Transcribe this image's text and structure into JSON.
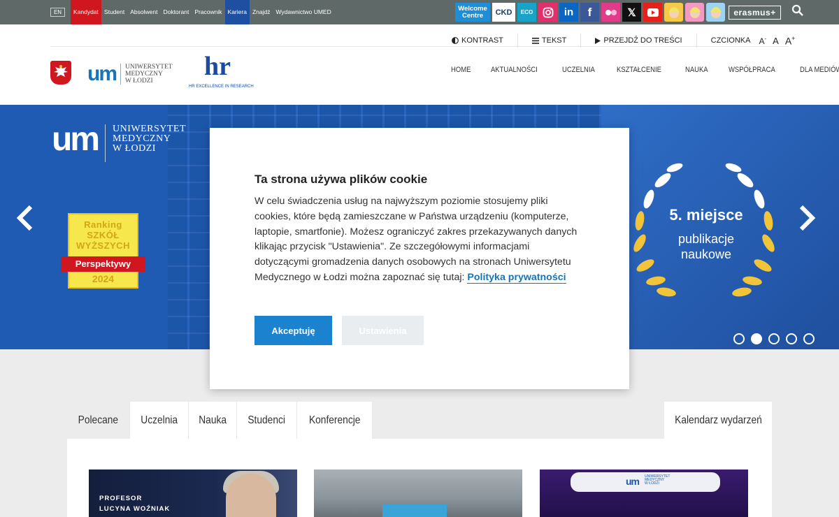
{
  "topbar": {
    "lang": "EN",
    "links": [
      {
        "label": "Kandydat",
        "style": "red"
      },
      {
        "label": "Student",
        "style": ""
      },
      {
        "label": "Absolwent",
        "style": ""
      },
      {
        "label": "Doktorant",
        "style": ""
      },
      {
        "label": "Pracownik",
        "style": ""
      },
      {
        "label": "Kariera",
        "style": "blue"
      },
      {
        "label": "Znajdź",
        "style": ""
      },
      {
        "label": "Wydawnictwo UMED",
        "style": ""
      }
    ],
    "social": {
      "welcome": "Welcome Centre",
      "ckd": "CKD",
      "eco": "ECO",
      "erasmus": "erasmus+"
    }
  },
  "utility": {
    "contrast": "KONTRAST",
    "text": "TEKST",
    "skip": "PRZEJDŹ DO TREŚCI",
    "font_label": "CZCIONKA",
    "font_small": "A-",
    "font_normal": "A",
    "font_large": "A+"
  },
  "logo": {
    "mark": "um",
    "line1": "UNIWERSYTET",
    "line2": "MEDYCZNY",
    "line3": "W ŁODZI"
  },
  "hr": {
    "mark": "hr",
    "caption": "HR EXCELLENCE IN RESEARCH"
  },
  "nav": [
    "HOME",
    "AKTUALNOŚCI",
    "UCZELNIA",
    "KSZTAŁCENIE",
    "NAUKA",
    "WSPÓŁPRACA",
    "DLA MEDIÓW"
  ],
  "hero": {
    "logo_mark": "um",
    "logo_line1": "UNIWERSYTET",
    "logo_line2": "MEDYCZNY",
    "logo_line3": "W ŁODZI",
    "ranking_line1": "Ranking",
    "ranking_line2": "SZKÓŁ",
    "ranking_line3": "WYŻSZYCH",
    "ranking_band": "Perspektywy",
    "ranking_year": "2024",
    "place": "5. miejsce",
    "place_sub1": "publikacje",
    "place_sub2": "naukowe",
    "slide_count": 5,
    "active_slide": 2
  },
  "cookie": {
    "title": "Ta strona używa plików cookie",
    "body": "W celu świadczenia usług na najwyższym poziomie stosujemy pliki cookies, które będą zamieszczane w Państwa urządzeniu (komputerze, laptopie, smartfonie). Możesz ograniczyć zakres przekazywanych danych klikając przycisk \"Ustawienia\". Ze szczegółowymi informacjami dotyczącymi gromadzenia danych osobowych na stronach Uniwersytetu Medycznego w Łodzi można zapoznać się tutaj: ",
    "link": "Polityka prywatności",
    "accept": "Akceptuję",
    "settings": "Ustawienia"
  },
  "tabs": [
    "Polecane",
    "Uczelnia",
    "Nauka",
    "Studenci",
    "Konferencje"
  ],
  "calendar": "Kalendarz wydarzeń",
  "cards": {
    "card1_line1": "PROFESOR",
    "card1_line2": "LUCYNA WOŹNIAK",
    "card3_mark": "um",
    "card3_line1": "UNIWERSYTET",
    "card3_line2": "MEDYCZNY",
    "card3_line3": "W ŁODZI"
  },
  "colors": {
    "topbar": "#5f6a68",
    "red": "#d0161e",
    "blue_link": "#1e4fa0",
    "hero": "#1f5ab3",
    "accent": "#1b82cf"
  }
}
